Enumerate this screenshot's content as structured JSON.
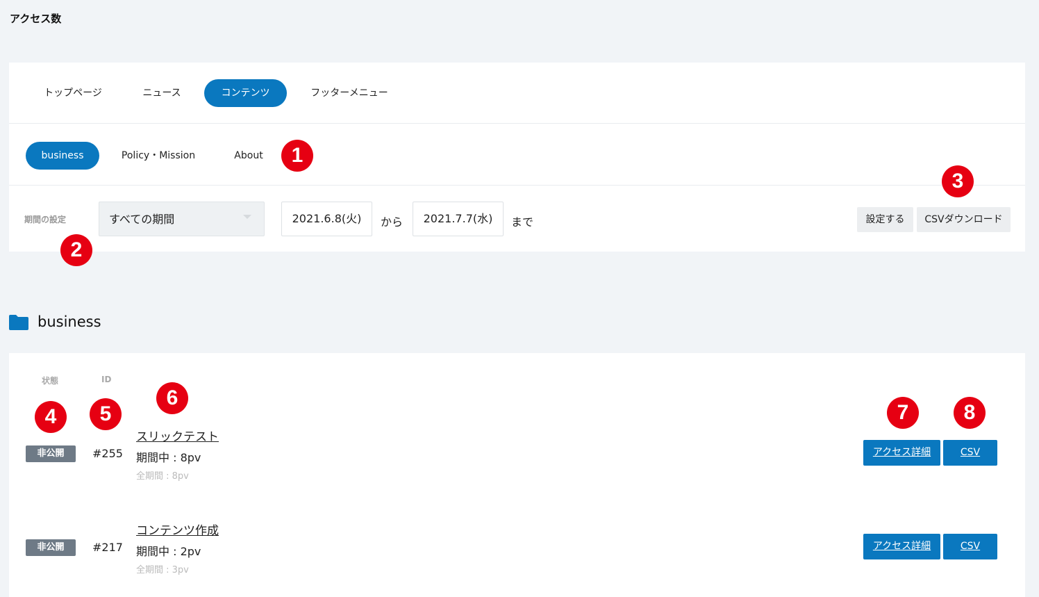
{
  "page_title": "アクセス数",
  "tabs": [
    {
      "label": "トップページ",
      "active": false
    },
    {
      "label": "ニュース",
      "active": false
    },
    {
      "label": "コンテンツ",
      "active": true
    },
    {
      "label": "フッターメニュー",
      "active": false
    }
  ],
  "subtabs": [
    {
      "label": "business",
      "active": true
    },
    {
      "label": "Policy・Mission",
      "active": false
    },
    {
      "label": "About",
      "active": false
    }
  ],
  "period": {
    "label": "期間の設定",
    "select_value": "すべての期間",
    "start_date": "2021.6.8(火)",
    "from_text": "から",
    "end_date": "2021.7.7(水)",
    "until_text": "まで",
    "apply_label": "設定する",
    "csv_download_label": "CSVダウンロード"
  },
  "markers": [
    "1",
    "2",
    "3",
    "4",
    "5",
    "6",
    "7",
    "8"
  ],
  "section": {
    "title": "business",
    "icon": "folder-icon"
  },
  "list": {
    "headers": {
      "status": "状態",
      "id": "ID"
    },
    "items": [
      {
        "status": "非公開",
        "id": "#255",
        "title": "スリックテスト",
        "period_pv": "期間中 : 8pv",
        "total_pv": "全期間 : 8pv",
        "detail_label": "アクセス詳細",
        "csv_label": "CSV"
      },
      {
        "status": "非公開",
        "id": "#217",
        "title": "コンテンツ作成",
        "period_pv": "期間中 : 2pv",
        "total_pv": "全期間 : 3pv",
        "detail_label": "アクセス詳細",
        "csv_label": "CSV"
      }
    ]
  },
  "colors": {
    "accent": "#0a78bf",
    "marker": "#e60012",
    "badge": "#6e7a86",
    "background": "#f1f4f7"
  }
}
